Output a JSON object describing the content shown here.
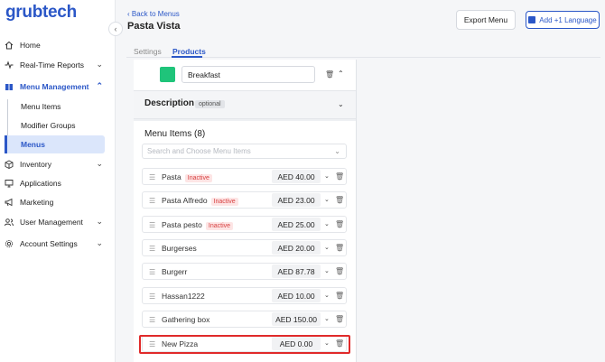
{
  "sidebar": {
    "logo": "grubtech",
    "items": [
      {
        "label": "Home",
        "icon": "home-icon"
      },
      {
        "label": "Real-Time Reports",
        "icon": "pulse-icon"
      },
      {
        "label": "Menu Management",
        "icon": "book-icon"
      },
      {
        "label": "Inventory",
        "icon": "box-icon"
      },
      {
        "label": "Applications",
        "icon": "monitor-icon"
      },
      {
        "label": "Marketing",
        "icon": "megaphone-icon"
      },
      {
        "label": "User Management",
        "icon": "users-icon"
      },
      {
        "label": "Account Settings",
        "icon": "gear-icon"
      }
    ],
    "sub_items": [
      {
        "label": "Menu Items"
      },
      {
        "label": "Modifier Groups"
      },
      {
        "label": "Menus"
      }
    ]
  },
  "header": {
    "back_label": "Back to Menus",
    "title": "Pasta Vista",
    "export_label": "Export Menu",
    "language_label": "Add +1 Language"
  },
  "tabs": [
    {
      "label": "Settings"
    },
    {
      "label": "Products"
    }
  ],
  "category": {
    "name_value": "Breakfast",
    "color": "#1fc47a",
    "description_label": "Description",
    "optional_label": "optional"
  },
  "menu_items": {
    "title": "Menu Items (8)",
    "search_placeholder": "Search and Choose Menu Items",
    "rows": [
      {
        "name": "Pasta",
        "badge": "Inactive",
        "price": "AED 40.00"
      },
      {
        "name": "Pasta Alfredo",
        "badge": "Inactive",
        "price": "AED 23.00"
      },
      {
        "name": "Pasta pesto",
        "badge": "Inactive",
        "price": "AED 25.00"
      },
      {
        "name": "Burgerses",
        "badge": "",
        "price": "AED 20.00"
      },
      {
        "name": "Burgerr",
        "badge": "",
        "price": "AED 87.78"
      },
      {
        "name": "Hassan1222",
        "badge": "",
        "price": "AED 10.00"
      },
      {
        "name": "Gathering box",
        "badge": "",
        "price": "AED 150.00"
      },
      {
        "name": "New Pizza",
        "badge": "",
        "price": "AED 0.00"
      }
    ]
  },
  "colors": {
    "accent": "#2b57c7",
    "highlight": "#e02a2a",
    "inactive": "#d84040"
  }
}
